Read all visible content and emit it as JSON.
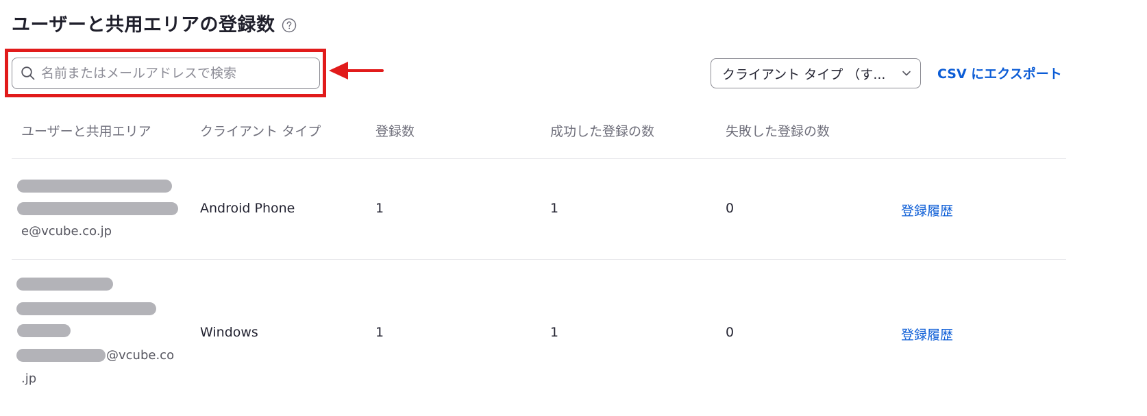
{
  "header": {
    "title": "ユーザーと共用エリアの登録数",
    "help_icon": "question-circle-icon"
  },
  "search": {
    "placeholder": "名前またはメールアドレスで検索",
    "value": ""
  },
  "filters": {
    "client_type_label": "クライアント タイプ （す...",
    "export_label": "CSV にエクスポート"
  },
  "annotation": {
    "highlight_color": "#e11b1b"
  },
  "table": {
    "columns": [
      "ユーザーと共用エリア",
      "クライアント タイプ",
      "登録数",
      "成功した登録の数",
      "失敗した登録の数"
    ],
    "rows": [
      {
        "user_lines": [
          "e@vcube.co.jp"
        ],
        "client_type": "Android Phone",
        "registrations": "1",
        "success": "1",
        "failed": "0",
        "action": "登録履歴"
      },
      {
        "user_lines": [
          "@vcube.co",
          ".jp"
        ],
        "client_type": "Windows",
        "registrations": "1",
        "success": "1",
        "failed": "0",
        "action": "登録履歴"
      }
    ]
  },
  "colors": {
    "accent": "#0b5cd6",
    "text": "#222230",
    "muted": "#6e6e7a"
  }
}
